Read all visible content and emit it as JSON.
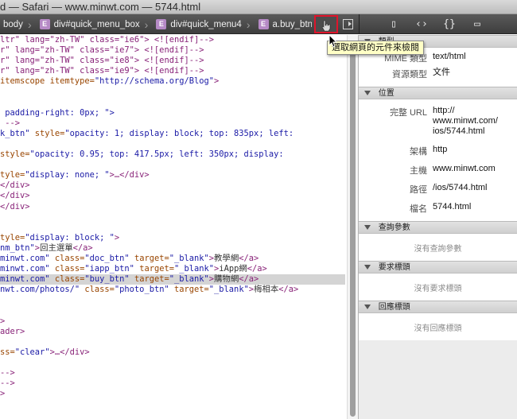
{
  "window": {
    "title": "d — Safari — www.minwt.com — 5744.html"
  },
  "breadcrumb": [
    {
      "badge": "",
      "label": "body"
    },
    {
      "badge": "E",
      "label": "div#quick_menu_box"
    },
    {
      "badge": "E",
      "label": "div#quick_menu4"
    },
    {
      "badge": "E",
      "label": "a.buy_btn"
    }
  ],
  "toolbar": {
    "inspect_tooltip": "選取網頁的元件來檢閱",
    "right_icons": [
      "▯",
      "‹›",
      "{}",
      "▭"
    ]
  },
  "code_lines": [
    [
      [
        "ltr\" lang=\"zh-TW\" class=\"ie6\"> <![endif]-->",
        "t"
      ]
    ],
    [
      [
        "r\" lang=\"zh-TW\" class=\"ie7\"> <![endif]-->",
        "t"
      ]
    ],
    [
      [
        "r\" lang=\"zh-TW\" class=\"ie8\"> <![endif]-->",
        "t"
      ]
    ],
    [
      [
        "r\" lang=\"zh-TW\" class=\"ie9\"> <![endif]-->",
        "t"
      ]
    ],
    [
      [
        "itemscope ",
        "a"
      ],
      [
        "itemtype=",
        "a"
      ],
      [
        "\"http://schema.org/Blog\"",
        "v"
      ],
      [
        ">",
        "t"
      ]
    ],
    [
      [
        "",
        ""
      ]
    ],
    [
      [
        "",
        ""
      ]
    ],
    [
      [
        " padding-right: 0px; \">",
        "v"
      ]
    ],
    [
      [
        " -->",
        "t"
      ]
    ],
    [
      [
        "k_btn\" ",
        "v"
      ],
      [
        "style=",
        "a"
      ],
      [
        "\"opacity: 1; display: block; top: 835px; left:",
        "v"
      ]
    ],
    [
      [
        "",
        ""
      ]
    ],
    [
      [
        "style=",
        "a"
      ],
      [
        "\"opacity: 0.95; top: 417.5px; left: 350px; display:",
        "v"
      ]
    ],
    [
      [
        "",
        ""
      ]
    ],
    [
      [
        "tyle=",
        "a"
      ],
      [
        "\"display: none; \"",
        "v"
      ],
      [
        ">…</div>",
        "t"
      ]
    ],
    [
      [
        "</div>",
        "t"
      ]
    ],
    [
      [
        "</div>",
        "t"
      ]
    ],
    [
      [
        "</div>",
        "t"
      ]
    ],
    [
      [
        "",
        ""
      ]
    ],
    [
      [
        "",
        ""
      ]
    ],
    [
      [
        "tyle=",
        "a"
      ],
      [
        "\"display: block; \"",
        "v"
      ],
      [
        ">",
        "t"
      ]
    ],
    [
      [
        "nm_btn\"",
        "v"
      ],
      [
        ">",
        "t"
      ],
      [
        "回主選單",
        "p"
      ],
      [
        "</a>",
        "t"
      ]
    ],
    [
      [
        "minwt.com\" ",
        "v"
      ],
      [
        "class=",
        "a"
      ],
      [
        "\"doc_btn\" ",
        "v"
      ],
      [
        "target=",
        "a"
      ],
      [
        "\"_blank\"",
        "v"
      ],
      [
        ">",
        "t"
      ],
      [
        "教學網",
        "p"
      ],
      [
        "</a>",
        "t"
      ]
    ],
    [
      [
        "minwt.com\" ",
        "v"
      ],
      [
        "class=",
        "a"
      ],
      [
        "\"iapp_btn\" ",
        "v"
      ],
      [
        "target=",
        "a"
      ],
      [
        "\"_blank\"",
        "v"
      ],
      [
        ">",
        "t"
      ],
      [
        "iApp網",
        "p"
      ],
      [
        "</a>",
        "t"
      ]
    ],
    [
      [
        "minwt.com\" ",
        "v"
      ],
      [
        "class=",
        "a"
      ],
      [
        "\"buy_btn\" ",
        "v"
      ],
      [
        "target=",
        "a"
      ],
      [
        "\"_blank\"",
        "v"
      ],
      [
        ">",
        "t"
      ],
      [
        "購物網",
        "p"
      ],
      [
        "</a>",
        "t"
      ]
    ],
    [
      [
        "nwt.com/photos/\" ",
        "v"
      ],
      [
        "class=",
        "a"
      ],
      [
        "\"photo_btn\" ",
        "v"
      ],
      [
        "target=",
        "a"
      ],
      [
        "\"_blank\"",
        "v"
      ],
      [
        ">",
        "t"
      ],
      [
        "梅相本",
        "p"
      ],
      [
        "</a>",
        "t"
      ]
    ],
    [
      [
        "",
        ""
      ]
    ],
    [
      [
        "",
        ""
      ]
    ],
    [
      [
        ">",
        "t"
      ]
    ],
    [
      [
        "ader>",
        "t"
      ]
    ],
    [
      [
        "",
        ""
      ]
    ],
    [
      [
        "ss=",
        "a"
      ],
      [
        "\"clear\"",
        "v"
      ],
      [
        ">…</div>",
        "t"
      ]
    ],
    [
      [
        "",
        ""
      ]
    ],
    [
      [
        "-->",
        "t"
      ]
    ],
    [
      [
        "-->",
        "t"
      ]
    ],
    [
      [
        ">",
        "t"
      ]
    ]
  ],
  "highlight_line": 23,
  "side": {
    "type_section": {
      "title": "類型",
      "rows": [
        {
          "key": "MIME 類型",
          "value": "text/html"
        },
        {
          "key": "資源類型",
          "value": "文件"
        }
      ]
    },
    "location_section": {
      "title": "位置",
      "rows": [
        {
          "key": "完整 URL",
          "value": "http:// www.minwt.com/ ios/5744.html"
        },
        {
          "key": "架構",
          "value": "http"
        },
        {
          "key": "主機",
          "value": "www.minwt.com"
        },
        {
          "key": "路徑",
          "value": "/ios/5744.html"
        },
        {
          "key": "檔名",
          "value": "5744.html"
        }
      ]
    },
    "query_section": {
      "title": "查詢參數",
      "empty": "沒有查詢參數"
    },
    "request_section": {
      "title": "要求標頭",
      "empty": "沒有要求標頭"
    },
    "response_section": {
      "title": "回應標頭",
      "empty": "沒有回應標頭"
    }
  }
}
